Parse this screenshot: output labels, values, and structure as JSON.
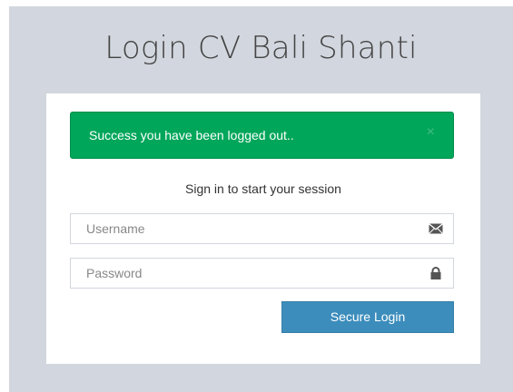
{
  "header": {
    "title": "Login CV Bali Shanti"
  },
  "alert": {
    "message": "Success you have been logged out..",
    "close_symbol": "×",
    "color": "#00a65a"
  },
  "login": {
    "prompt": "Sign in to start your session",
    "username_placeholder": "Username",
    "username_value": "",
    "username_icon": "envelope-icon",
    "password_placeholder": "Password",
    "password_value": "",
    "password_icon": "lock-icon",
    "submit_label": "Secure Login",
    "submit_color": "#3c8dbc"
  },
  "background_color": "#d2d6de"
}
